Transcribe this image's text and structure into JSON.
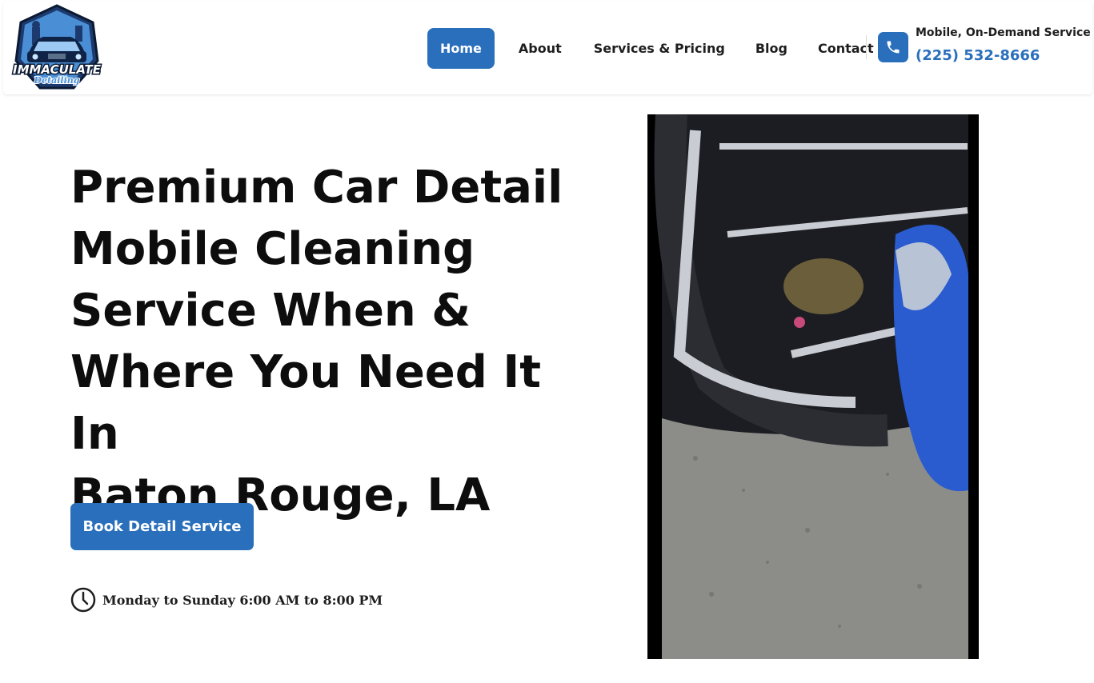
{
  "header": {
    "logo": {
      "line1": "IMMACULATE",
      "line2": "Detailing"
    },
    "nav": [
      {
        "label": "Home",
        "active": true
      },
      {
        "label": "About",
        "active": false
      },
      {
        "label": "Services & Pricing",
        "active": false
      },
      {
        "label": "Blog",
        "active": false
      },
      {
        "label": "Contact",
        "active": false
      }
    ],
    "contact": {
      "icon": "phone-icon",
      "label": "Mobile, On-Demand Service",
      "phone": "(225) 532-8666"
    }
  },
  "hero": {
    "title_lines": [
      "Premium Car Detail",
      "Mobile Cleaning",
      "Service When &",
      "Where You Need It In",
      "Baton Rouge, LA"
    ],
    "cta_label": "Book Detail Service",
    "hours_icon": "clock-icon",
    "hours": "Monday to Sunday 6:00 AM to 8:00 PM"
  },
  "colors": {
    "accent": "#2a6fbb",
    "text": "#0d0d0d"
  }
}
